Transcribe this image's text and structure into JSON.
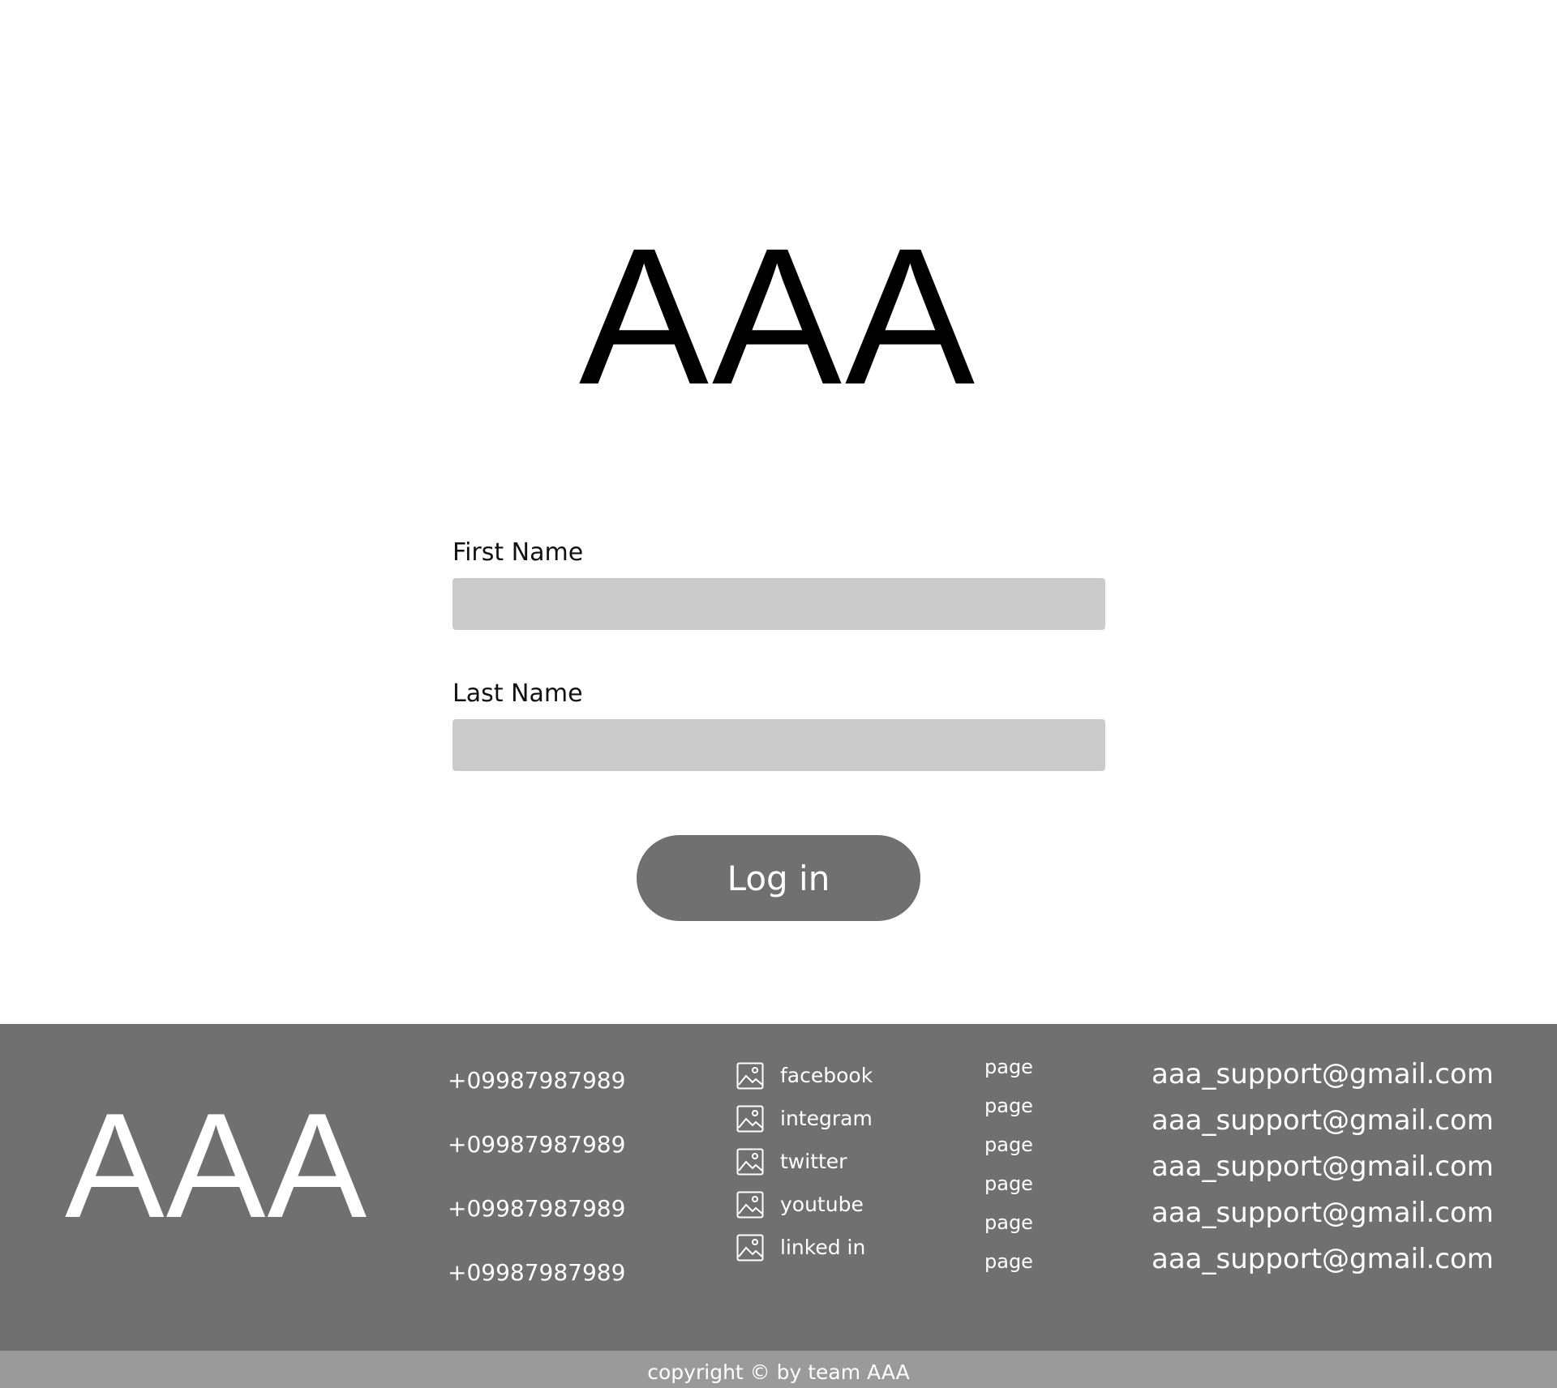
{
  "hero": {
    "logo": "AAA"
  },
  "form": {
    "first_name_label": "First Name",
    "first_name_value": "",
    "first_name_placeholder": "",
    "last_name_label": "Last Name",
    "last_name_value": "",
    "last_name_placeholder": "",
    "login_label": "Log in"
  },
  "footer": {
    "logo": "AAA",
    "phones": [
      "+09987987989",
      "+09987987989",
      "+09987987989",
      "+09987987989"
    ],
    "social": [
      {
        "label": "facebook",
        "icon": "image-icon"
      },
      {
        "label": "integram",
        "icon": "image-icon"
      },
      {
        "label": "twitter",
        "icon": "image-icon"
      },
      {
        "label": "youtube",
        "icon": "image-icon"
      },
      {
        "label": "linked in",
        "icon": "image-icon"
      }
    ],
    "pages": [
      "page",
      "page",
      "page",
      "page",
      "page",
      "page"
    ],
    "emails": [
      "aaa_support@gmail.com",
      "aaa_support@gmail.com",
      "aaa_support@gmail.com",
      "aaa_support@gmail.com",
      "aaa_support@gmail.com"
    ],
    "copyright": "copyright © by team AAA"
  },
  "colors": {
    "footer_bg": "#707070",
    "copyright_bg": "#9a9a9a",
    "input_bg": "#cbcbcb",
    "button_bg": "#707070",
    "text_dark": "#000000",
    "text_light": "#ffffff"
  }
}
